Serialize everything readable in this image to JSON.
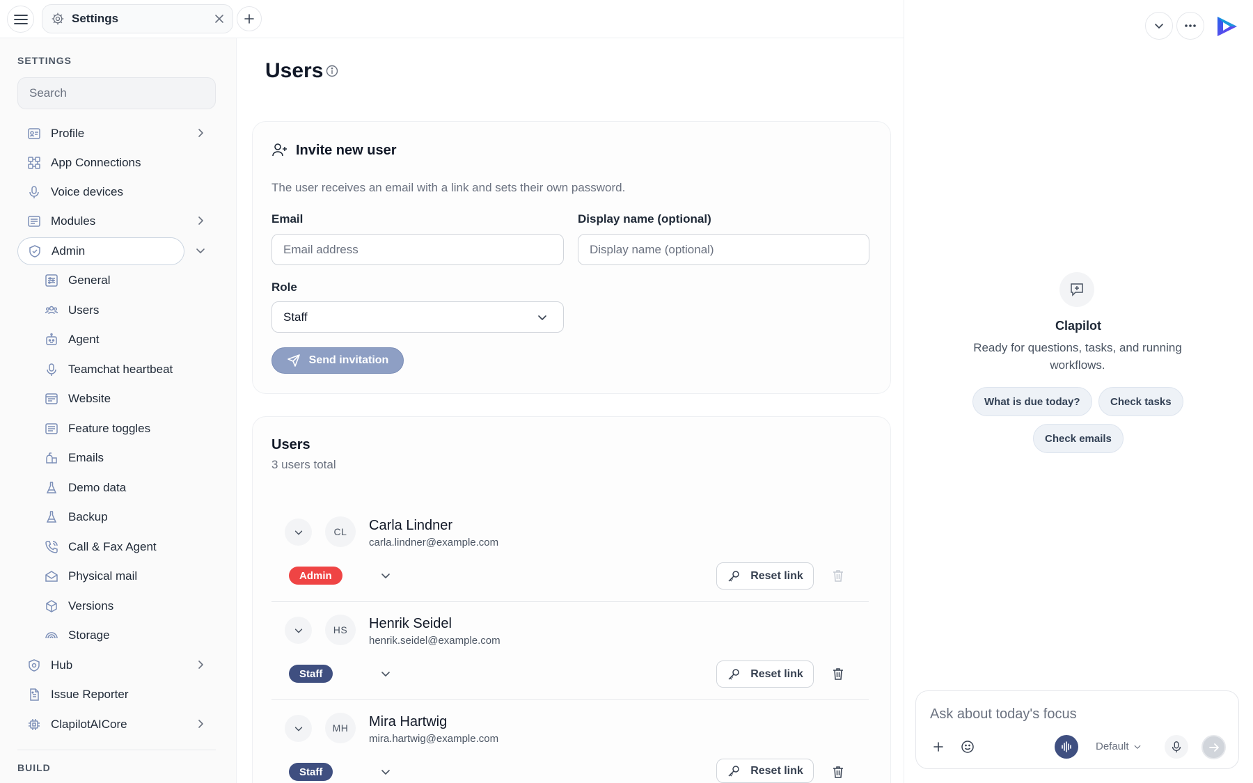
{
  "tab": {
    "label": "Settings"
  },
  "sidebar": {
    "settings_heading": "SETTINGS",
    "search_placeholder": "Search",
    "items": [
      {
        "label": "Profile",
        "icon": "profile-card-icon",
        "has_chevron": true
      },
      {
        "label": "App Connections",
        "icon": "connections-icon"
      },
      {
        "label": "Voice devices",
        "icon": "microphone-icon"
      },
      {
        "label": "Modules",
        "icon": "modules-icon",
        "has_chevron": true
      },
      {
        "label": "Admin",
        "icon": "shield-check-icon",
        "expanded": true,
        "active": true
      }
    ],
    "admin_items": [
      {
        "label": "General",
        "icon": "sliders-icon"
      },
      {
        "label": "Users",
        "icon": "users-icon",
        "selected": true
      },
      {
        "label": "Agent",
        "icon": "robot-icon"
      },
      {
        "label": "Teamchat heartbeat",
        "icon": "microphone-icon"
      },
      {
        "label": "Website",
        "icon": "browser-window-icon"
      },
      {
        "label": "Feature toggles",
        "icon": "toggles-icon"
      },
      {
        "label": "Emails",
        "icon": "mailbox-icon"
      },
      {
        "label": "Demo data",
        "icon": "flask-icon"
      },
      {
        "label": "Backup",
        "icon": "flask-icon"
      },
      {
        "label": "Call & Fax Agent",
        "icon": "phone-icon"
      },
      {
        "label": "Physical mail",
        "icon": "envelope-icon"
      },
      {
        "label": "Versions",
        "icon": "cube-icon"
      },
      {
        "label": "Storage",
        "icon": "storage-icon"
      }
    ],
    "bottom_items": [
      {
        "label": "Hub",
        "icon": "hub-shield-icon",
        "has_chevron": true
      },
      {
        "label": "Issue Reporter",
        "icon": "document-icon"
      },
      {
        "label": "ClapilotAICore",
        "icon": "chip-icon",
        "has_chevron": true
      }
    ],
    "build_heading": "BUILD"
  },
  "main": {
    "title": "Users",
    "invite": {
      "title": "Invite new user",
      "description": "The user receives an email with a link and sets their own password.",
      "email_label": "Email",
      "email_placeholder": "Email address",
      "display_name_label": "Display name (optional)",
      "display_name_placeholder": "Display name (optional)",
      "role_label": "Role",
      "role_value": "Staff",
      "send_label": "Send invitation"
    },
    "users": {
      "title": "Users",
      "count_text": "3 users total",
      "reset_label": "Reset link",
      "list": [
        {
          "initials": "CL",
          "name": "Carla Lindner",
          "email": "carla.lindner@example.com",
          "role": "Admin",
          "role_color": "#ef4444"
        },
        {
          "initials": "HS",
          "name": "Henrik Seidel",
          "email": "henrik.seidel@example.com",
          "role": "Staff",
          "role_color": "#3f4f80"
        },
        {
          "initials": "MH",
          "name": "Mira Hartwig",
          "email": "mira.hartwig@example.com",
          "role": "Staff",
          "role_color": "#3f4f80"
        }
      ]
    }
  },
  "assistant": {
    "name": "Clapilot",
    "description": "Ready for questions, tasks, and running workflows.",
    "chips": [
      "What is due today?",
      "Check tasks",
      "Check emails"
    ],
    "composer_placeholder": "Ask about today's focus",
    "model_label": "Default"
  },
  "colors": {
    "accent": "#3f4f80",
    "admin_badge": "#ef4444",
    "send_button": "#8e9fc4"
  }
}
